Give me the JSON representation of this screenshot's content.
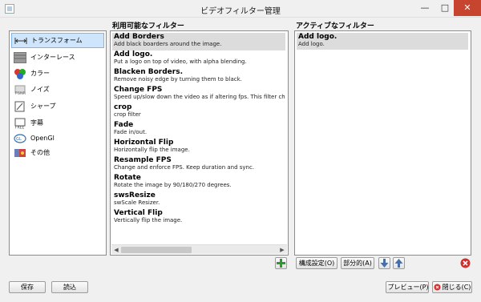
{
  "window": {
    "title": "ビデオフィルター管理"
  },
  "headings": {
    "available": "利用可能なフィルター",
    "active": "アクティブなフィルター"
  },
  "categories": [
    {
      "label": "トランスフォーム",
      "icon": "transform-icon",
      "selected": true
    },
    {
      "label": "インターレース",
      "icon": "interlace-icon"
    },
    {
      "label": "カラー",
      "icon": "color-icon"
    },
    {
      "label": "ノイズ",
      "icon": "noise-icon"
    },
    {
      "label": "シャープ",
      "icon": "sharpen-icon"
    },
    {
      "label": "字幕",
      "icon": "subtitle-icon"
    },
    {
      "label": "OpenGl",
      "icon": "opengl-icon"
    },
    {
      "label": "その他",
      "icon": "misc-icon"
    }
  ],
  "available_filters": [
    {
      "name": "Add Borders",
      "desc": "Add black boarders around the image.",
      "selected": true
    },
    {
      "name": "Add logo.",
      "desc": "Put a logo on top of video, with alpha blending."
    },
    {
      "name": "Blacken Borders.",
      "desc": "Remove noisy edge by turning them to black."
    },
    {
      "name": "Change FPS",
      "desc": "Speed up/slow down the video as if altering fps. This filter changes d"
    },
    {
      "name": "crop",
      "desc": "crop filter"
    },
    {
      "name": "Fade",
      "desc": "Fade in/out."
    },
    {
      "name": "Horizontal Flip",
      "desc": "Horizontally flip the image."
    },
    {
      "name": "Resample FPS",
      "desc": "Change and enforce FPS. Keep duration and sync."
    },
    {
      "name": "Rotate",
      "desc": "Rotate the image by 90/180/270 degrees."
    },
    {
      "name": "swsResize",
      "desc": "swScale Resizer."
    },
    {
      "name": "Vertical Flip",
      "desc": "Vertically flip the image."
    }
  ],
  "active_filters": [
    {
      "name": "Add logo.",
      "desc": "Add logo."
    }
  ],
  "buttons": {
    "configure": "構成設定(O)",
    "partial": "部分的(A)",
    "save": "保存",
    "load": "読込",
    "preview": "プレビュー(P)",
    "close": "閉じる(C)"
  },
  "colors": {
    "selection": "#cfe5fb",
    "close_red": "#c7452f",
    "add_green": "#2e9a2e"
  }
}
